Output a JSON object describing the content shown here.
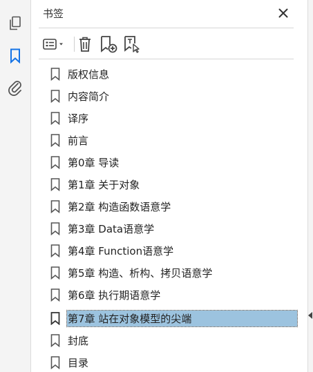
{
  "panel": {
    "title": "书签"
  },
  "leftbar": {
    "icons": [
      "pages-icon",
      "bookmark-icon",
      "attachment-icon"
    ],
    "active_color": "#1473e6"
  },
  "toolbar": {
    "buttons": [
      "options-menu-icon",
      "delete-bookmark-icon",
      "new-bookmark-icon",
      "new-bookmark-from-structure-icon"
    ]
  },
  "bookmarks": [
    {
      "label": "版权信息"
    },
    {
      "label": "内容简介"
    },
    {
      "label": "译序"
    },
    {
      "label": "前言"
    },
    {
      "label": "第0章 导读"
    },
    {
      "label": "第1章 关于对象"
    },
    {
      "label": "第2章 构造函数语意学"
    },
    {
      "label": "第3章 Data语意学"
    },
    {
      "label": "第4章 Function语意学"
    },
    {
      "label": "第5章 构造、析构、拷贝语意学"
    },
    {
      "label": "第6章 执行期语意学"
    },
    {
      "label": "第7章 站在对象模型的尖端",
      "selected": true
    },
    {
      "label": "封底"
    },
    {
      "label": "目录"
    }
  ],
  "colors": {
    "selection": "#9cc3df"
  }
}
